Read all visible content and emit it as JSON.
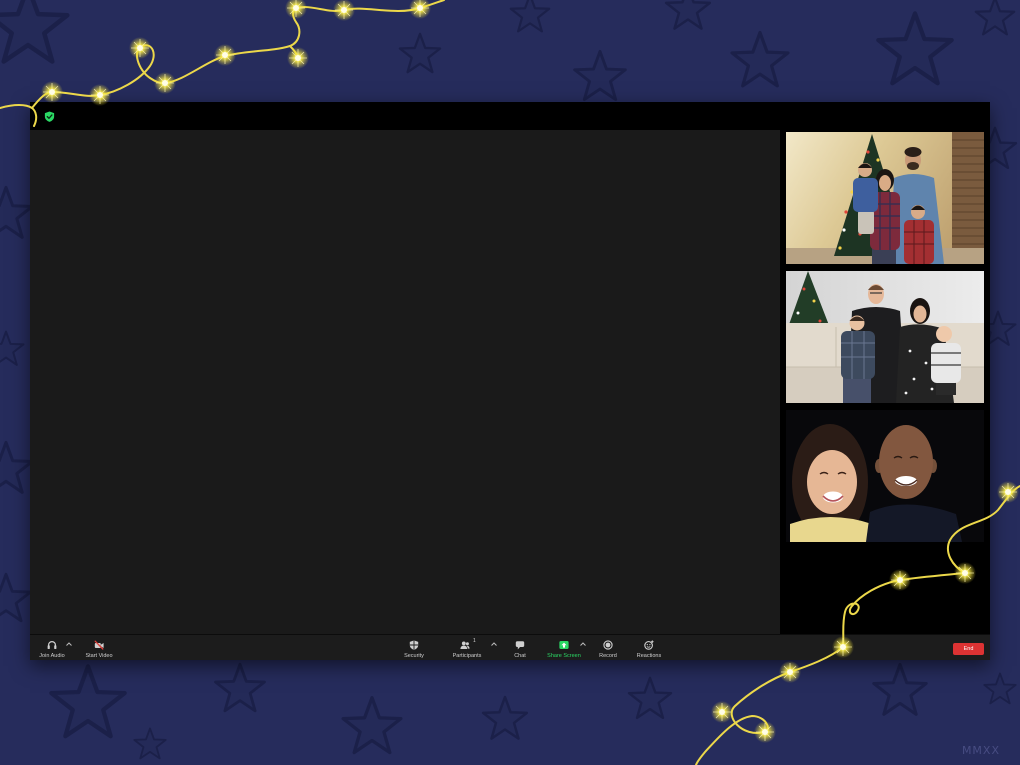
{
  "theme": {
    "background": "#262c5c",
    "window_bar": "#000000",
    "stage": "#1a1a1a",
    "toolbar": "#1c1c1c",
    "accent_green": "#2bd965",
    "end_red": "#dd3333",
    "wire_yellow": "#ecd84a"
  },
  "top_bar": {
    "security_icon": "shield-check-icon"
  },
  "toolbar": {
    "join_audio": {
      "label": "Join Audio",
      "icon": "headphones-icon"
    },
    "start_video": {
      "label": "Start Video",
      "icon": "video-off-icon"
    },
    "security": {
      "label": "Security",
      "icon": "shield-icon"
    },
    "participants": {
      "label": "Participants",
      "count": "1",
      "icon": "participants-icon"
    },
    "chat": {
      "label": "Chat",
      "icon": "chat-icon"
    },
    "share_screen": {
      "label": "Share Screen",
      "icon": "share-screen-icon"
    },
    "record": {
      "label": "Record",
      "icon": "record-icon"
    },
    "reactions": {
      "label": "Reactions",
      "icon": "reactions-icon"
    },
    "end": {
      "label": "End"
    }
  },
  "decor": {
    "caption": "MMXX"
  }
}
